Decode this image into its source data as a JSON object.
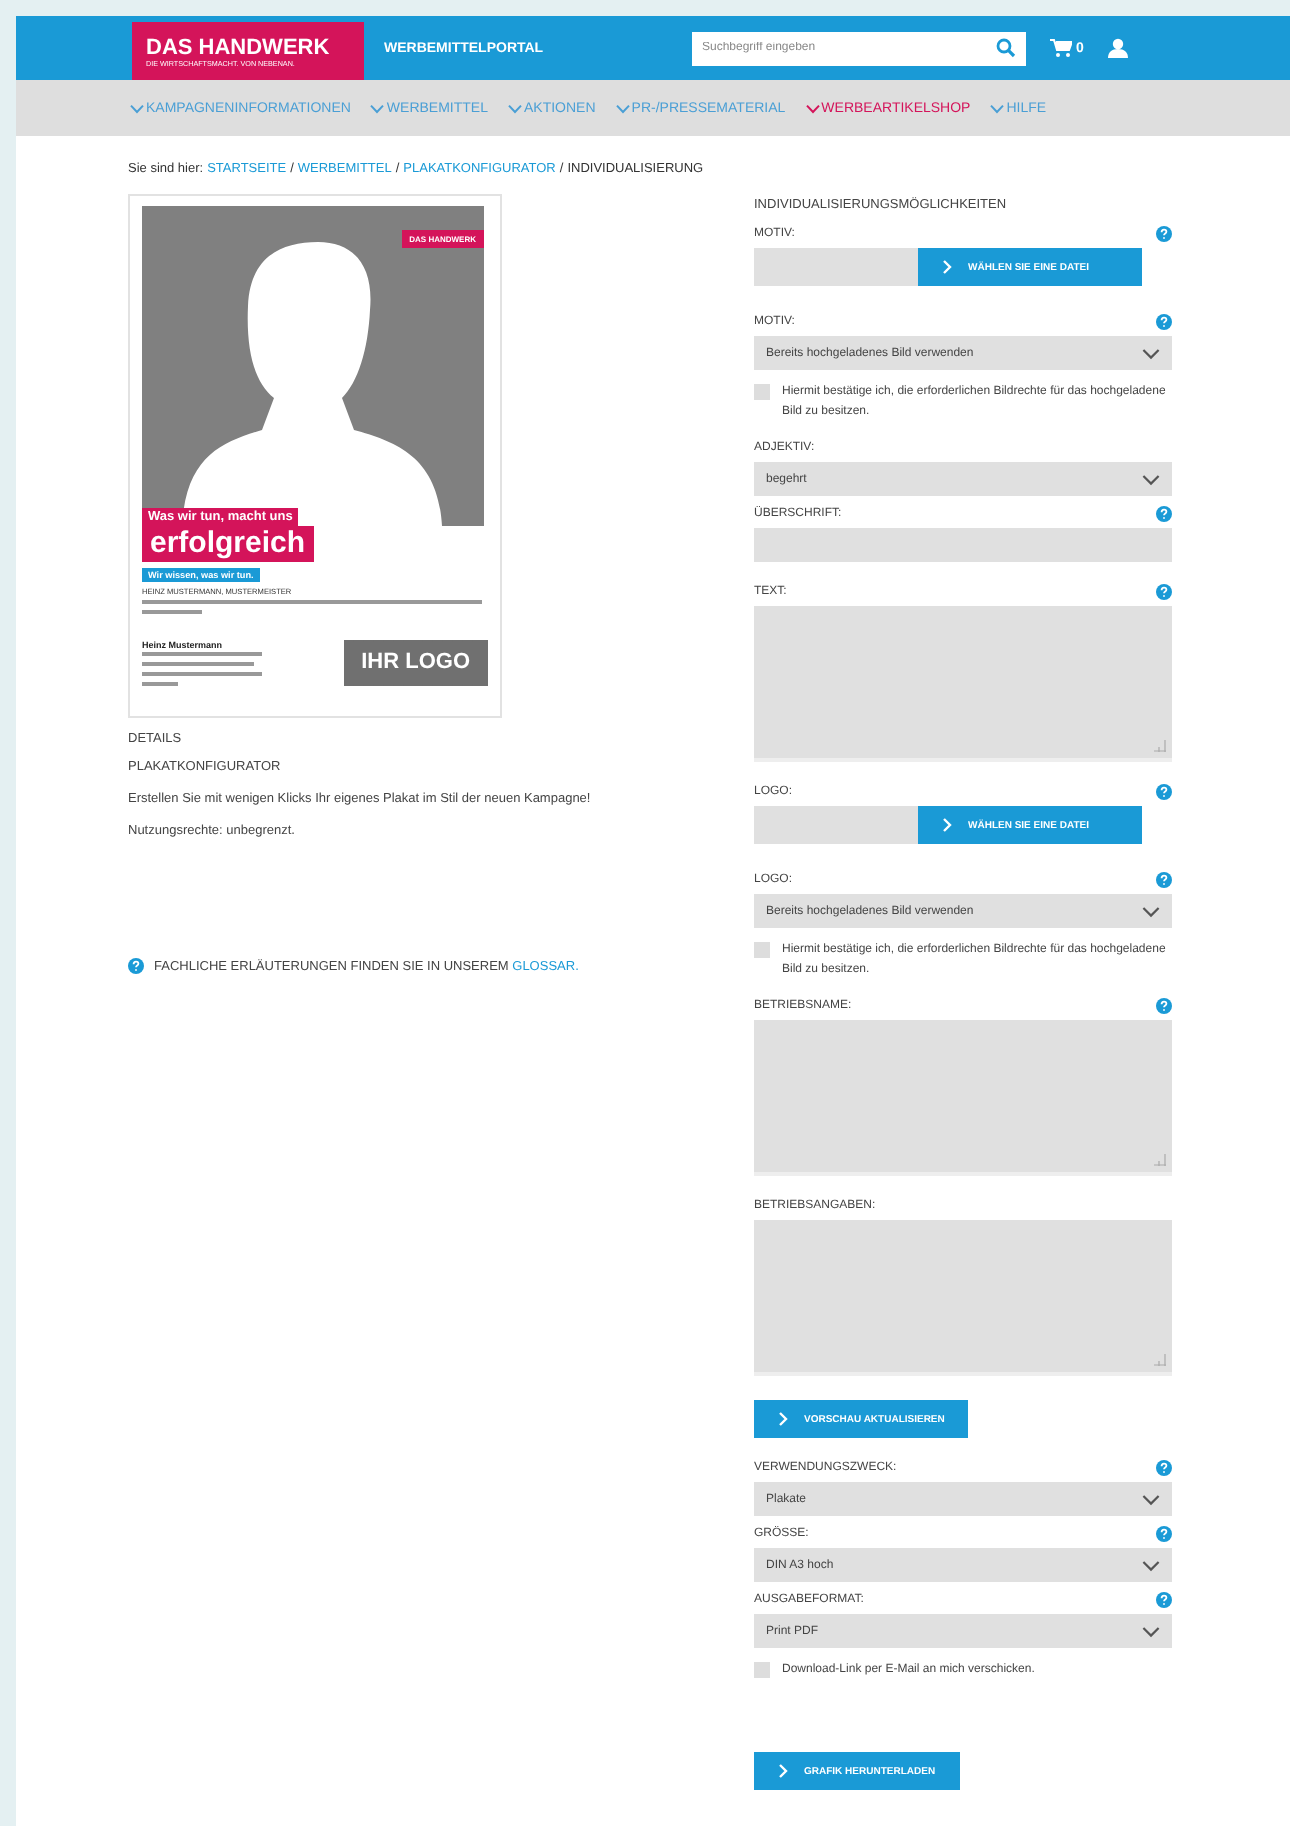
{
  "header": {
    "logo_title": "DAS HANDWERK",
    "logo_subtitle": "DIE WIRTSCHAFTSMACHT. VON NEBENAN.",
    "portal_title": "WERBEMITTELPORTAL",
    "search": {
      "placeholder": "Suchbegriff eingeben"
    },
    "cart_count": "0"
  },
  "nav": [
    {
      "label": "KAMPAGNENINFORMATIONEN",
      "selected": false
    },
    {
      "label": "WERBEMITTEL",
      "selected": false
    },
    {
      "label": "AKTIONEN",
      "selected": false
    },
    {
      "label": "PR-/PRESSEMATERIAL",
      "selected": false
    },
    {
      "label": "WERBEARTIKELSHOP",
      "selected": true
    },
    {
      "label": "HILFE",
      "selected": false
    }
  ],
  "breadcrumb": {
    "prefix": "Sie sind hier:",
    "links": [
      {
        "label": "STARTSEITE",
        "separator": "/"
      },
      {
        "label": "WERBEMITTEL",
        "separator": "/"
      },
      {
        "label": "PLAKATKONFIGURATOR",
        "separator": "/"
      }
    ],
    "current": "INDIVIDUALISIERUNG"
  },
  "poster": {
    "badge": "DAS HANDWERK",
    "headline_small": "Was wir tun, macht uns",
    "headline_large": "erfolgreich",
    "tagline": "Wir wissen, was wir tun.",
    "name_line": "HEINZ MUSTERMANN, MUSTERMEISTER",
    "contact_name": "Heinz Mustermann",
    "logo": "IHR LOGO"
  },
  "details": {
    "heading": "DETAILS",
    "title": "PLAKATKONFIGURATOR",
    "description": "Erstellen Sie mit wenigen Klicks Ihr eigenes Plakat im Stil der neuen Kampagne!",
    "rights": "Nutzungsrechte: unbegrenzt."
  },
  "glossary_note": {
    "text": "FACHLICHE ERLÄUTERUNGEN FINDEN SIE IN UNSEREM",
    "link": "GLOSSAR."
  },
  "form": {
    "heading": "INDIVIDUALISIERUNGSMÖGLICHKEITEN",
    "fields": [
      {
        "kind": "file",
        "label": "MOTIV:",
        "help": true,
        "button": "WÄHLEN SIE EINE DATEI"
      },
      {
        "kind": "select",
        "label": "MOTIV:",
        "help": true,
        "value": "Bereits hochgeladenes Bild verwenden"
      },
      {
        "kind": "checkbox",
        "label": "Hiermit bestätige ich, die erforderlichen Bildrechte für das hochgeladene Bild zu besitzen.",
        "checked": false
      },
      {
        "kind": "select",
        "label": "ADJEKTIV:",
        "help": false,
        "value": "begehrt"
      },
      {
        "kind": "text",
        "label": "ÜBERSCHRIFT:",
        "help": true
      },
      {
        "kind": "textarea",
        "label": "TEXT:",
        "help": true
      },
      {
        "kind": "file",
        "label": "LOGO:",
        "help": true,
        "button": "WÄHLEN SIE EINE DATEI"
      },
      {
        "kind": "select",
        "label": "LOGO:",
        "help": true,
        "value": "Bereits hochgeladenes Bild verwenden"
      },
      {
        "kind": "checkbox",
        "label": "Hiermit bestätige ich, die erforderlichen Bildrechte für das hochgeladene Bild zu besitzen.",
        "checked": false
      },
      {
        "kind": "textarea",
        "label": "BETRIEBSNAME:",
        "help": true
      },
      {
        "kind": "textarea",
        "label": "BETRIEBSANGABEN:",
        "help": false
      },
      {
        "kind": "button",
        "label": "VORSCHAU AKTUALISIEREN"
      },
      {
        "kind": "select",
        "label": "VERWENDUNGSZWECK:",
        "help": true,
        "value": "Plakate"
      },
      {
        "kind": "select",
        "label": "GRÖSSE:",
        "help": true,
        "value": "DIN A3 hoch"
      },
      {
        "kind": "select",
        "label": "AUSGABEFORMAT:",
        "help": true,
        "value": "Print PDF"
      },
      {
        "kind": "checkbox",
        "label": "Download-Link per E-Mail an mich verschicken.",
        "checked": false
      },
      {
        "kind": "button",
        "label": "GRAFIK HERUNTERLADEN"
      }
    ]
  }
}
